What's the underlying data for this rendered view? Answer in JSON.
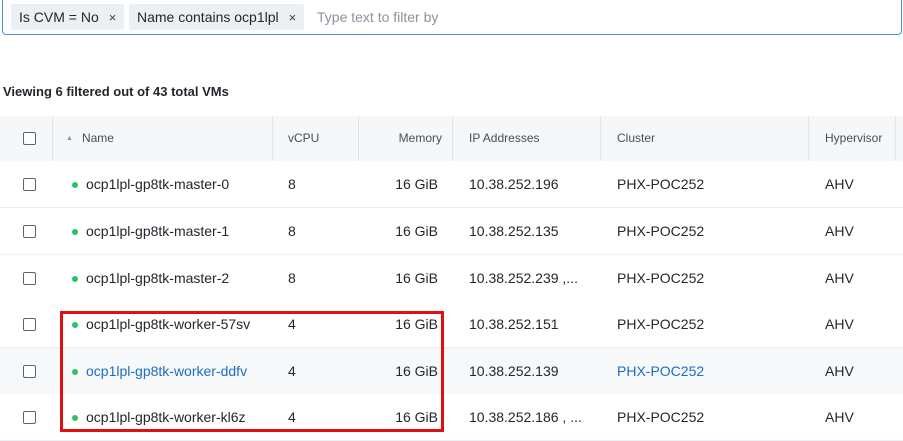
{
  "filters": {
    "chips": [
      {
        "label": "Is CVM = No",
        "remove": "×"
      },
      {
        "label": "Name contains ocp1lpl",
        "remove": "×"
      }
    ],
    "placeholder": "Type text to filter by"
  },
  "summary": "Viewing 6 filtered out of 43 total VMs",
  "columns": {
    "name": "Name",
    "vcpu": "vCPU",
    "memory": "Memory",
    "ip": "IP Addresses",
    "cluster": "Cluster",
    "hypervisor": "Hypervisor"
  },
  "rows": [
    {
      "name": "ocp1lpl-gp8tk-master-0",
      "vcpu": "8",
      "memory": "16 GiB",
      "ip": "10.38.252.196",
      "cluster": "PHX-POC252",
      "hypervisor": "AHV"
    },
    {
      "name": "ocp1lpl-gp8tk-master-1",
      "vcpu": "8",
      "memory": "16 GiB",
      "ip": "10.38.252.135",
      "cluster": "PHX-POC252",
      "hypervisor": "AHV"
    },
    {
      "name": "ocp1lpl-gp8tk-master-2",
      "vcpu": "8",
      "memory": "16 GiB",
      "ip": "10.38.252.239 ,...",
      "cluster": "PHX-POC252",
      "hypervisor": "AHV"
    },
    {
      "name": "ocp1lpl-gp8tk-worker-57sv",
      "vcpu": "4",
      "memory": "16 GiB",
      "ip": "10.38.252.151",
      "cluster": "PHX-POC252",
      "hypervisor": "AHV"
    },
    {
      "name": "ocp1lpl-gp8tk-worker-ddfv",
      "vcpu": "4",
      "memory": "16 GiB",
      "ip": "10.38.252.139",
      "cluster": "PHX-POC252",
      "hypervisor": "AHV"
    },
    {
      "name": "ocp1lpl-gp8tk-worker-kl6z",
      "vcpu": "4",
      "memory": "16 GiB",
      "ip": "10.38.252.186 , ...",
      "cluster": "PHX-POC252",
      "hypervisor": "AHV"
    }
  ],
  "colors": {
    "status_on": "#2ec35b",
    "link": "#1b6ec2",
    "highlight": "#e01010",
    "filter_border": "#4a90d9"
  }
}
